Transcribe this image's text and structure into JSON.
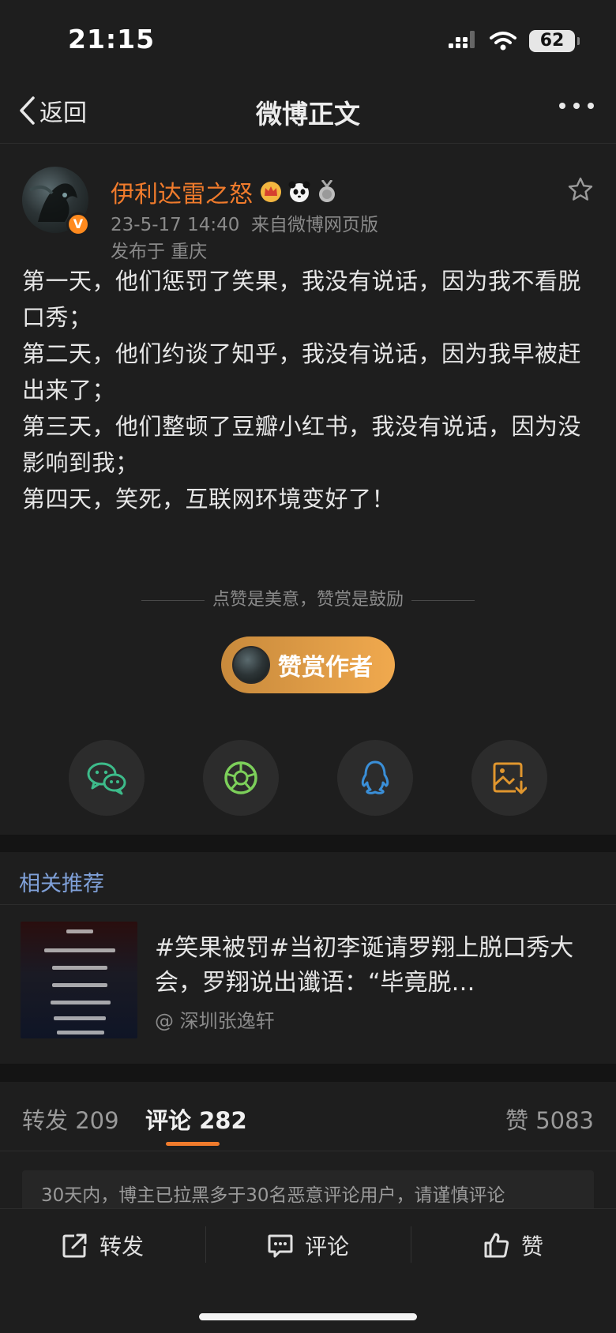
{
  "status": {
    "time": "21:15",
    "battery": "62"
  },
  "nav": {
    "back_label": "返回",
    "title": "微博正文"
  },
  "post": {
    "username": "伊利达雷之怒",
    "verified_badge": "V",
    "timestamp": "23-5-17 14:40",
    "source": "来自微博网页版",
    "location": "发布于 重庆",
    "paragraphs": [
      "第一天，他们惩罚了笑果，我没有说话，因为我不看脱口秀；",
      "第二天，他们约谈了知乎，我没有说话，因为我早被赶出来了；",
      "第三天，他们整顿了豆瓣小红书，我没有说话，因为没影响到我；",
      "第四天，笑死，互联网环境变好了！"
    ],
    "like_note": "点赞是美意，赞赏是鼓励",
    "reward_label": "赞赏作者"
  },
  "share": {
    "items": [
      "wechat-icon",
      "moments-icon",
      "qq-icon",
      "save-image-icon"
    ],
    "colors": {
      "wechat": "#3dbb8a",
      "moments": "#7ccf5a",
      "qq": "#3a8fd8",
      "save": "#e0962e"
    }
  },
  "related": {
    "title": "相关推荐",
    "headline": "#笑果被罚#当初李诞请罗翔上脱口秀大会，罗翔说出谶语：“毕竟脱…",
    "source": "@ 深圳张逸轩"
  },
  "tabs": {
    "repost_label": "转发",
    "repost_count": "209",
    "comment_label": "评论",
    "comment_count": "282",
    "like_label": "赞",
    "like_count": "5083"
  },
  "notice": "30天内，博主已拉黑多于30名恶意评论用户，请谨慎评论",
  "bottom": {
    "repost": "转发",
    "comment": "评论",
    "like": "赞"
  },
  "theme": {
    "accent": "#f07b2c",
    "link": "#7fa0d8",
    "background": "#1e1e1e"
  }
}
